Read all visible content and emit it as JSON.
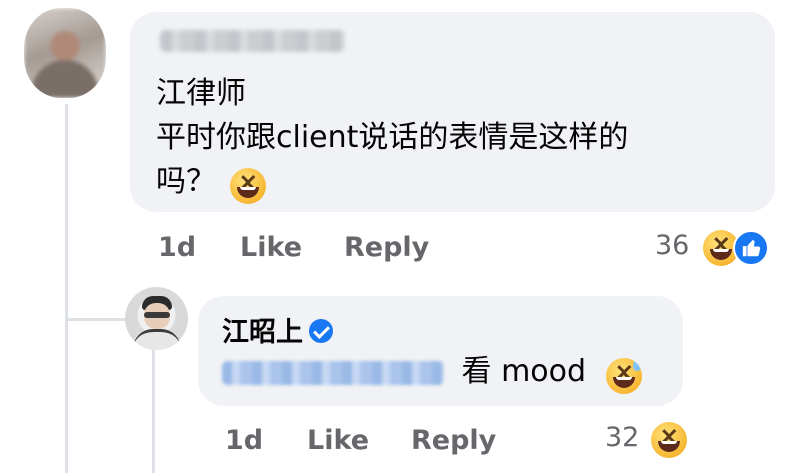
{
  "comment": {
    "text_line1": "江律师",
    "text_line2": "平时你跟client说话的表情是这样的",
    "text_line3": "吗？",
    "emoji_icon": "laughing-squint-emoji",
    "actions": {
      "time": "1d",
      "like": "Like",
      "reply": "Reply"
    },
    "reaction_count": "36",
    "reaction_icons": [
      "laughing-squint-emoji",
      "like-thumbs-up-icon"
    ]
  },
  "reply": {
    "author": "江昭上",
    "verified_icon": "verified-badge-icon",
    "text": "看 mood",
    "emoji_icon": "grinning-sweat-emoji",
    "actions": {
      "time": "1d",
      "like": "Like",
      "reply": "Reply"
    },
    "reaction_count": "32",
    "reaction_icons": [
      "laughing-squint-emoji"
    ]
  },
  "colors": {
    "bubble": "#f0f2f5",
    "muted_text": "#65676b",
    "brand_blue": "#1877f2",
    "thread_line": "#dde0e4"
  }
}
